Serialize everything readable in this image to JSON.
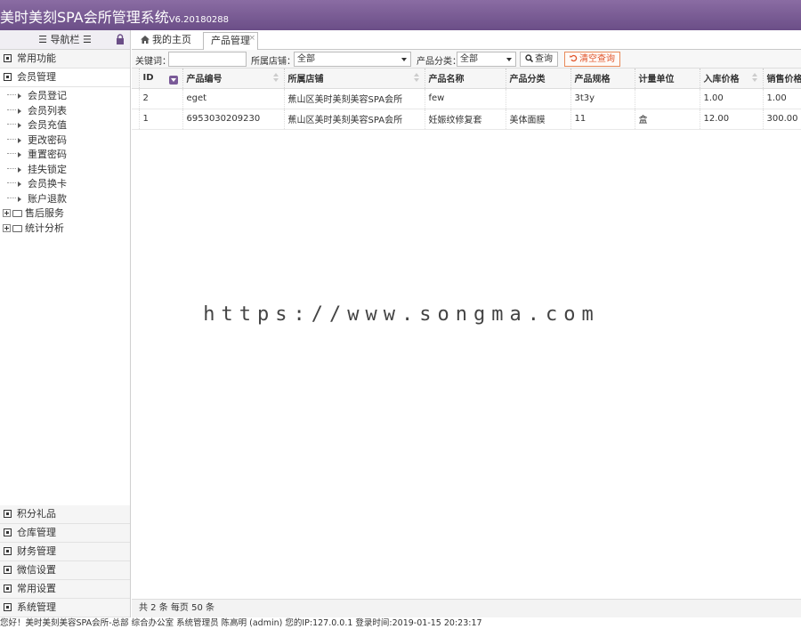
{
  "header": {
    "title": "美时美刻SPA会所管理系统",
    "version": "V6.20180288"
  },
  "sidebar": {
    "nav_title": "☰ 导航栏 ☰",
    "top_menus": [
      {
        "label": "常用功能"
      },
      {
        "label": "会员管理"
      }
    ],
    "member_items": [
      {
        "label": "会员登记"
      },
      {
        "label": "会员列表"
      },
      {
        "label": "会员充值"
      },
      {
        "label": "更改密码"
      },
      {
        "label": "重置密码"
      },
      {
        "label": "挂失锁定"
      },
      {
        "label": "会员换卡"
      },
      {
        "label": "账户退款"
      }
    ],
    "folders": [
      {
        "label": "售后服务"
      },
      {
        "label": "统计分析"
      }
    ],
    "bottom_menus": [
      {
        "label": "积分礼品"
      },
      {
        "label": "仓库管理"
      },
      {
        "label": "财务管理"
      },
      {
        "label": "微信设置"
      },
      {
        "label": "常用设置"
      },
      {
        "label": "系统管理"
      }
    ]
  },
  "tabs": {
    "home": "我的主页",
    "product": "产品管理",
    "close": "×"
  },
  "toolbar": {
    "keyword_label": "关键词：",
    "keyword_value": "",
    "store_label": "所属店铺：",
    "store_value": "全部",
    "category_label": "产品分类：",
    "category_value": "全部",
    "search_btn": "查询",
    "clear_btn": "清空查询"
  },
  "table": {
    "headers": [
      "ID",
      "产品编号",
      "所属店铺",
      "产品名称",
      "产品分类",
      "产品规格",
      "计量单位",
      "入库价格",
      "销售价格"
    ],
    "rows": [
      [
        "2",
        "eget",
        "蕉山区美时美刻美容SPA会所",
        "few",
        "",
        "3t3y",
        "",
        "1.00",
        "1.00"
      ],
      [
        "1",
        "6953030209230",
        "蕉山区美时美刻美容SPA会所",
        "妊娠纹修复套",
        "美体面膜",
        "11",
        "盒",
        "12.00",
        "300.00"
      ]
    ]
  },
  "watermark": "https://www.songma.com",
  "pager": "共 2 条 每页 50 条",
  "statusbar": "您好！美时美刻美容SPA会所-总部 综合办公室 系统管理员 陈高明 (admin) 您的IP:127.0.0.1 登录时间:2019-01-15 20:23:17",
  "colors": {
    "header_top": "#8a6ca3",
    "header_bottom": "#6b4e87",
    "accent": "#7a5a98",
    "clear_button": "#e0552b"
  }
}
